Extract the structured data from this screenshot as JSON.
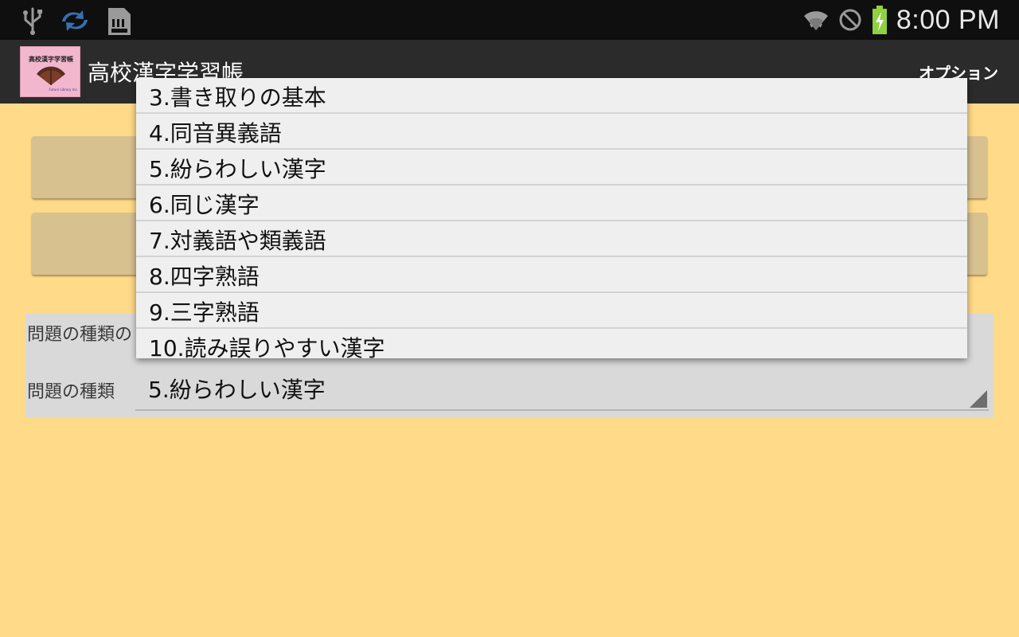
{
  "status_bar": {
    "left_icons": [
      "usb-icon",
      "sync-icon",
      "sd-card-icon"
    ],
    "right_icons": [
      "wifi-icon",
      "blocked-icon",
      "battery-charging-icon"
    ],
    "time": "8:00 PM"
  },
  "action_bar": {
    "app_title": "高校漢字学習帳",
    "options_label": "オプション",
    "app_icon": {
      "title": "高校漢字学習帳",
      "subtitle": "Future Library Inc."
    }
  },
  "panel": {
    "label1": "問題の種類の",
    "label2": "問題の種類",
    "spinner_value": "5.紛らわしい漢字"
  },
  "dropdown": {
    "items": [
      "3.書き取りの基本",
      "4.同音異義語",
      "5.紛らわしい漢字",
      "6.同じ漢字",
      "7.対義語や類義語",
      "8.四字熟語",
      "9.三字熟語",
      "10.読み誤りやすい漢字"
    ]
  },
  "colors": {
    "background": "#ffda88",
    "status_bar": "#0f0f0f",
    "action_bar": "#2b2b2b",
    "button": "#d7c18f",
    "panel": "#d9d9d9",
    "dropdown": "#efefef",
    "battery": "#8fd13f"
  }
}
